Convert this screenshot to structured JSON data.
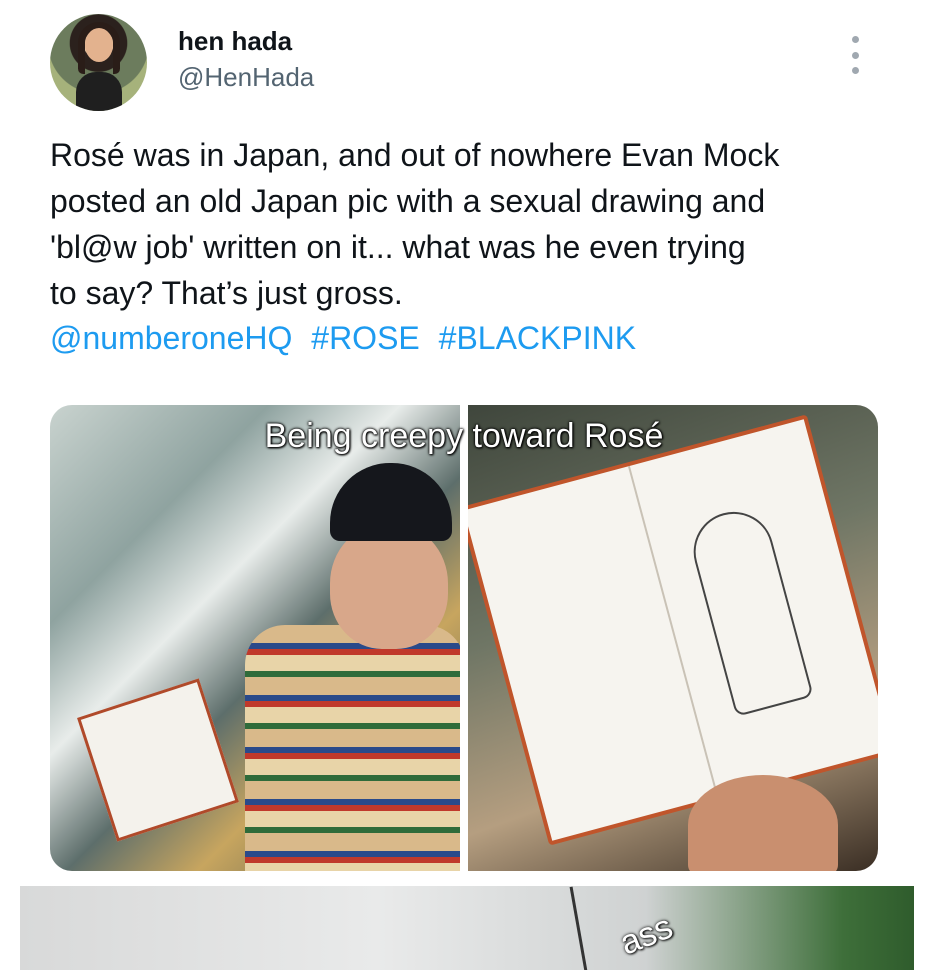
{
  "user": {
    "display_name": "hen hada",
    "handle": "@HenHada"
  },
  "tweet": {
    "text_lines": [
      "Rosé was in Japan, and out of nowhere Evan Mock",
      "posted an old Japan pic with a sexual drawing and",
      "'bl@w job' written on it... what was he even trying",
      "to say? That’s just gross."
    ],
    "mention": "@numberoneHQ",
    "hashtags": [
      "#ROSE",
      "#BLACKPINK"
    ]
  },
  "media": {
    "caption": "Being creepy toward Rosé",
    "second_caption": "ass"
  },
  "colors": {
    "link": "#1d9bf0",
    "handle": "#536471",
    "text": "#0f1419"
  }
}
